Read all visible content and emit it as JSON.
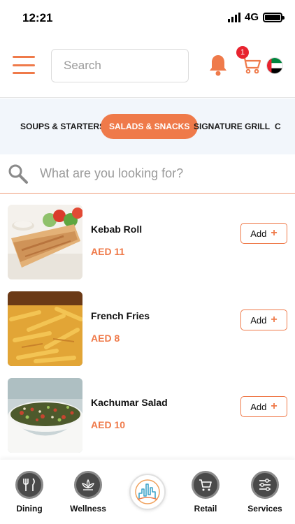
{
  "status": {
    "time": "12:21",
    "network": "4G"
  },
  "header": {
    "search_placeholder": "Search",
    "cart_count": "1"
  },
  "categories": [
    {
      "label": "SOUPS & STARTERS",
      "active": false
    },
    {
      "label": "SALADS & SNACKS",
      "active": true
    },
    {
      "label": "SIGNATURE GRILL",
      "active": false
    },
    {
      "label": "C",
      "active": false
    }
  ],
  "item_search": {
    "placeholder": "What are you looking for?"
  },
  "items": [
    {
      "name": "Kebab Roll",
      "price": "AED 11",
      "add_label": "Add"
    },
    {
      "name": "French Fries",
      "price": "AED 8",
      "add_label": "Add"
    },
    {
      "name": "Kachumar Salad",
      "price": "AED 10",
      "add_label": "Add"
    }
  ],
  "bottom_nav": [
    {
      "label": "Dining",
      "icon": "dining-icon"
    },
    {
      "label": "Wellness",
      "icon": "lotus-icon"
    },
    {
      "label": "",
      "icon": "city-skyline-logo"
    },
    {
      "label": "Retail",
      "icon": "shopping-cart-icon"
    },
    {
      "label": "Services",
      "icon": "sliders-icon"
    }
  ],
  "colors": {
    "accent": "#ef7a4a",
    "badge": "#e8232f",
    "category_bg": "#f2f6fb"
  }
}
